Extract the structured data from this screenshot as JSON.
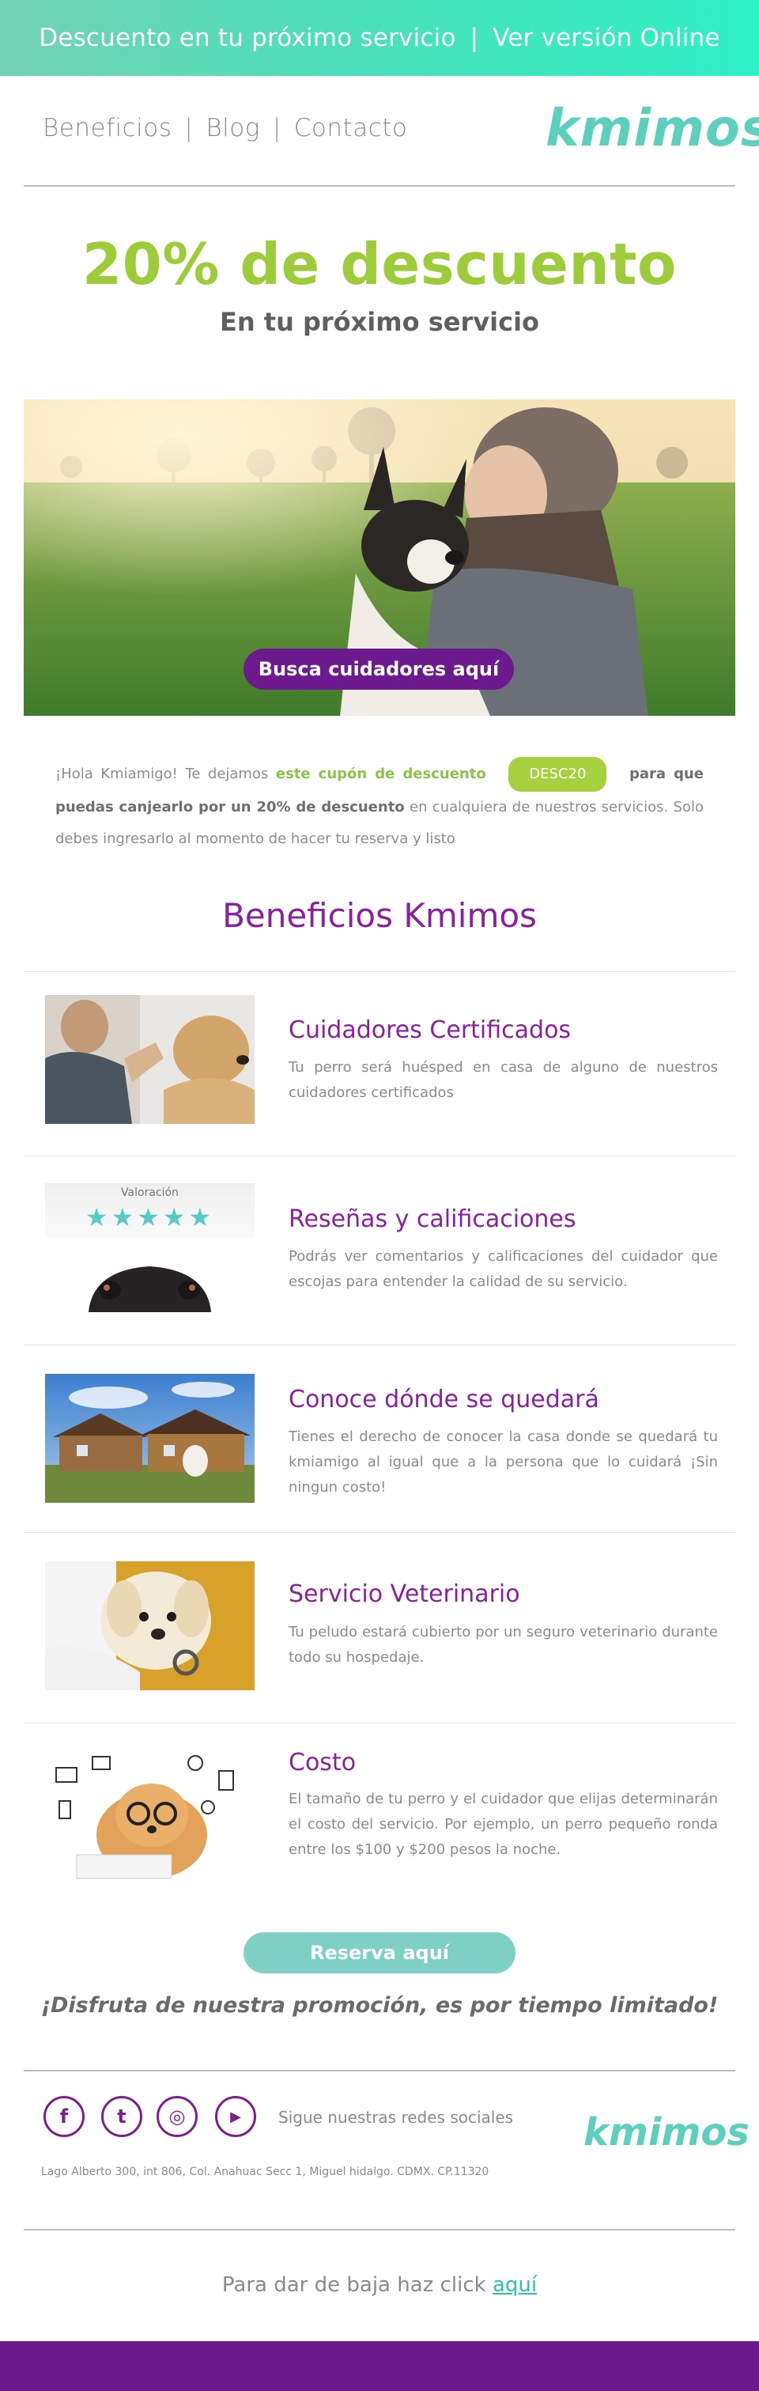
{
  "topbar": {
    "left_text": "Descuento en tu próximo servicio",
    "separator": "|",
    "right_text": "Ver versión Online"
  },
  "nav": {
    "items": [
      "Beneficios",
      "Blog",
      "Contacto"
    ],
    "separator": "|"
  },
  "brand": {
    "logo_text": "kmimos",
    "accent": "#5ccfbd",
    "primary": "#8a1fa0",
    "green": "#9dcc3a"
  },
  "hero": {
    "title": "20% de descuento",
    "subtitle": "En tu próximo servicio",
    "cta_label": "Busca cuidadores aquí",
    "cta_color": "#6c1a8e"
  },
  "intro": {
    "part1": "¡Hola Kmiamigo! Te dejamos",
    "highlight": "este cupón de descuento",
    "code": "DESC20",
    "part2": "para que puedas canjearlo por un 20% de descuento",
    "part3": "en cualquiera de nuestros servicios. Solo debes ingresarlo al momento de hacer tu reserva y listo"
  },
  "benefits_title": "Beneficios Kmimos",
  "benefits": [
    {
      "title": "Cuidadores Certificados",
      "desc": "Tu perro será huésped en casa de alguno de nuestros cuidadores certificados",
      "image": "man-high-five-dog"
    },
    {
      "title": "Reseñas y calificaciones",
      "desc": "Podrás ver comentarios y calificaciones del cuidador que escojas para entender la calidad de su servicio.",
      "image": "rating-dog",
      "image_caption": "Valoración",
      "stars": 5
    },
    {
      "title": "Conoce dónde se quedará",
      "desc": "Tienes el derecho de conocer la casa donde se quedará tu kmiamigo al igual que a la persona que lo cuidará ¡Sin ningun costo!",
      "image": "house-with-dogs"
    },
    {
      "title": "Servicio Veterinario",
      "desc": "Tu peludo estará cubierto por un seguro veterinario durante todo su hospedaje.",
      "image": "vet-puppy"
    },
    {
      "title": "Costo",
      "desc": "El tamaño de tu perro y el cuidador que elijas determinarán el costo del servicio. Por ejemplo, un perro pequeño ronda entre los $100 y $200 pesos la noche.",
      "image": "pomeranian-glasses"
    }
  ],
  "cta2_label": "Reserva aquí",
  "closing": "¡Disfruta de nuestra promoción, es por tiempo limitado!",
  "footer": {
    "social_icons": [
      "facebook-icon",
      "twitter-icon",
      "instagram-icon",
      "youtube-icon"
    ],
    "social_glyphs": [
      "f",
      "t",
      "◎",
      "▶"
    ],
    "social_text": "Sigue nuestras redes sociales",
    "address": "Lago Alberto 300, int 806, Col. Anahuac Secc 1, Miguel hidalgo. CDMX. CP.11320",
    "unsubscribe_text": "Para dar de baja haz click",
    "unsubscribe_link": "aquí"
  }
}
